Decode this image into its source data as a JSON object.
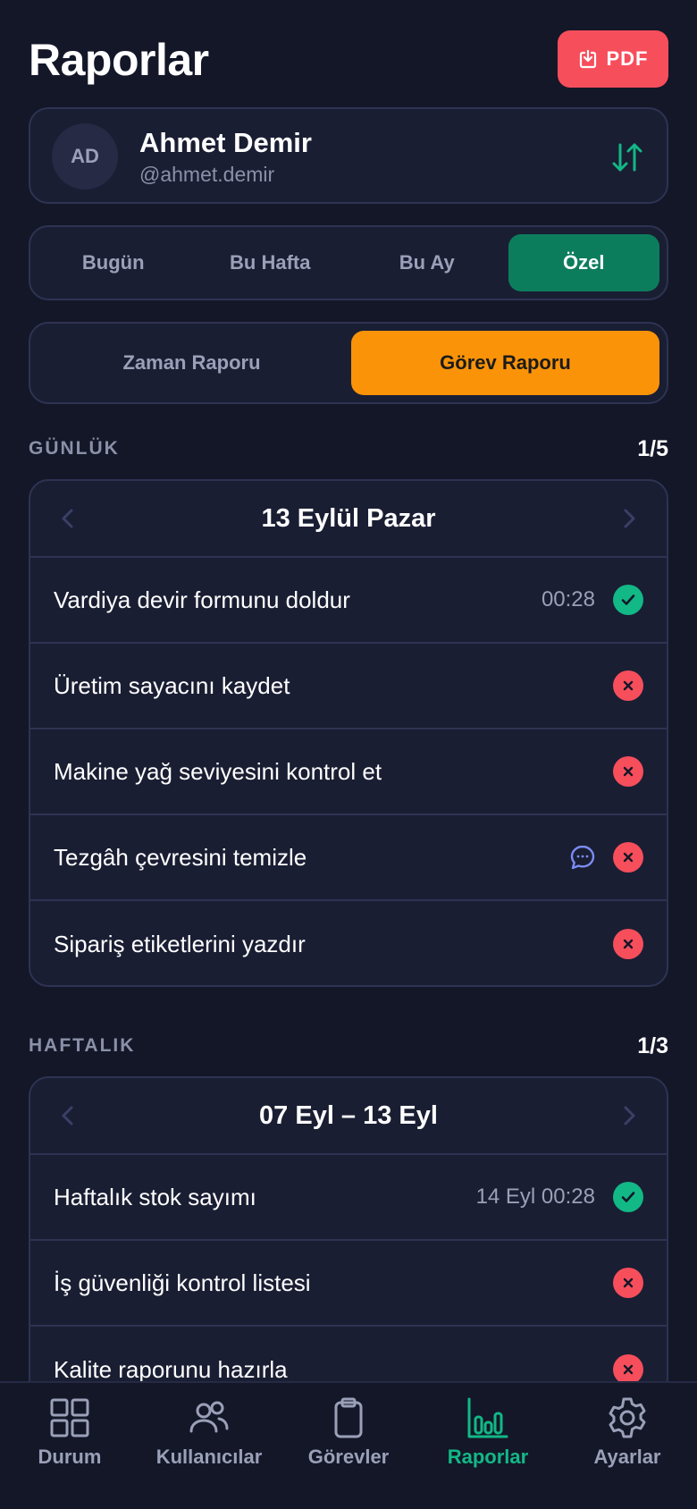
{
  "header": {
    "title": "Raporlar",
    "pdf_label": "PDF"
  },
  "user": {
    "initials": "AD",
    "name": "Ahmet Demir",
    "handle": "@ahmet.demir"
  },
  "period_tabs": [
    {
      "label": "Bugün",
      "active": false
    },
    {
      "label": "Bu Hafta",
      "active": false
    },
    {
      "label": "Bu Ay",
      "active": false
    },
    {
      "label": "Özel",
      "active": true
    }
  ],
  "report_tabs": [
    {
      "label": "Zaman Raporu",
      "active": false
    },
    {
      "label": "Görev Raporu",
      "active": true
    }
  ],
  "daily": {
    "label": "GÜNLÜK",
    "count": "1/5",
    "date": "13 Eylül Pazar",
    "rows": [
      {
        "task": "Vardiya devir formunu doldur",
        "time": "00:28",
        "status": "done",
        "comment": false
      },
      {
        "task": "Üretim sayacını kaydet",
        "time": "",
        "status": "missed",
        "comment": false
      },
      {
        "task": "Makine yağ seviyesini kontrol et",
        "time": "",
        "status": "missed",
        "comment": false
      },
      {
        "task": "Tezgâh çevresini temizle",
        "time": "",
        "status": "missed",
        "comment": true
      },
      {
        "task": "Sipariş etiketlerini yazdır",
        "time": "",
        "status": "missed",
        "comment": false
      }
    ]
  },
  "weekly": {
    "label": "HAFTALIK",
    "count": "1/3",
    "date": "07 Eyl – 13 Eyl",
    "rows": [
      {
        "task": "Haftalık stok sayımı",
        "time": "14 Eyl 00:28",
        "status": "done",
        "comment": false
      },
      {
        "task": "İş güvenliği kontrol listesi",
        "time": "",
        "status": "missed",
        "comment": false
      },
      {
        "task": "Kalite raporunu hazırla",
        "time": "",
        "status": "missed",
        "comment": false
      }
    ]
  },
  "nav": [
    {
      "label": "Durum",
      "icon": "grid-icon",
      "active": false
    },
    {
      "label": "Kullanıcılar",
      "icon": "users-icon",
      "active": false
    },
    {
      "label": "Görevler",
      "icon": "clipboard-icon",
      "active": false
    },
    {
      "label": "Raporlar",
      "icon": "bar-chart-icon",
      "active": true
    },
    {
      "label": "Ayarlar",
      "icon": "gear-icon",
      "active": false
    }
  ],
  "colors": {
    "background": "#141728",
    "card": "#1a1e33",
    "accent_green": "#12b886",
    "active_period": "#0c7d5c",
    "active_report": "#fb9309",
    "danger": "#f74e5c",
    "comment_icon": "#7b8cf2"
  }
}
